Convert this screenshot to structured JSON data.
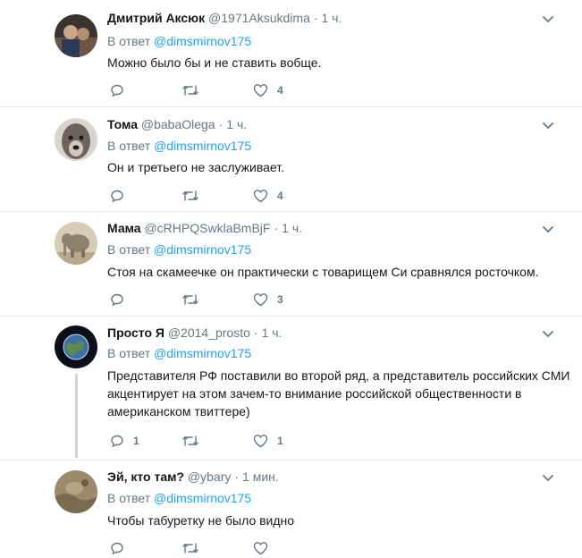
{
  "reply_prefix": "В ответ",
  "tweets": [
    {
      "name": "Дмитрий Аксюк",
      "handle": "@1971Aksukdima",
      "time": "1 ч.",
      "reply_to": "@dimsmirnov175",
      "text": "Можно было бы и не ставить вобще.",
      "replies": "",
      "likes": "4",
      "avatar_color": "#5b4a3c"
    },
    {
      "name": "Тома",
      "handle": "@babaOlega",
      "time": "1 ч.",
      "reply_to": "@dimsmirnov175",
      "text": "Он и третьего не заслуживает.",
      "replies": "",
      "likes": "4",
      "avatar_color": "#7a6f66"
    },
    {
      "name": "Мама",
      "handle": "@cRHPQSwklaBmBjF",
      "time": "1 ч.",
      "reply_to": "@dimsmirnov175",
      "text": "Стоя на скамеечке он практически с товарищем Си сравнялся росточком.",
      "replies": "",
      "likes": "3",
      "avatar_color": "#b7a78f"
    },
    {
      "name": "Просто Я",
      "handle": "@2014_prosto",
      "time": "1 ч.",
      "reply_to": "@dimsmirnov175",
      "text": "Представителя РФ поставили во второй ряд, а представитель российских СМИ акцентирует на этом зачем-то внимание российской общественности в американском твиттере)",
      "replies": "1",
      "likes": "1",
      "avatar_color": "#1a2130"
    },
    {
      "name": "Эй, кто там?",
      "handle": "@ybary",
      "time": "1 мин.",
      "reply_to": "@dimsmirnov175",
      "text": "Чтобы табуретку не было видно",
      "replies": "",
      "likes": "",
      "avatar_color": "#8b7a5e"
    }
  ]
}
